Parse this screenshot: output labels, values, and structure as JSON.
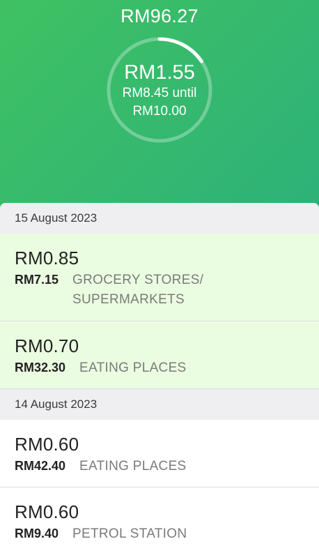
{
  "summary": {
    "total_cashback": "RM96.27",
    "progress_amount": "RM1.55",
    "remaining_line1": "RM8.45 until",
    "remaining_line2": "RM10.00",
    "progress_fraction": 0.155
  },
  "colors": {
    "gradient_start": "#3fc162",
    "gradient_end": "#29a88a",
    "highlight_row": "#ebfde0",
    "date_header_bg": "#efeff2"
  },
  "groups": [
    {
      "date": "15 August 2023",
      "transactions": [
        {
          "cashback": "RM0.85",
          "spent": "RM7.15",
          "category": "GROCERY STORES/ SUPERMARKETS",
          "highlighted": true
        },
        {
          "cashback": "RM0.70",
          "spent": "RM32.30",
          "category": "EATING PLACES",
          "highlighted": true
        }
      ]
    },
    {
      "date": "14 August 2023",
      "transactions": [
        {
          "cashback": "RM0.60",
          "spent": "RM42.40",
          "category": "EATING PLACES",
          "highlighted": false
        },
        {
          "cashback": "RM0.60",
          "spent": "RM9.40",
          "category": "PETROL STATION",
          "highlighted": false
        }
      ]
    }
  ]
}
